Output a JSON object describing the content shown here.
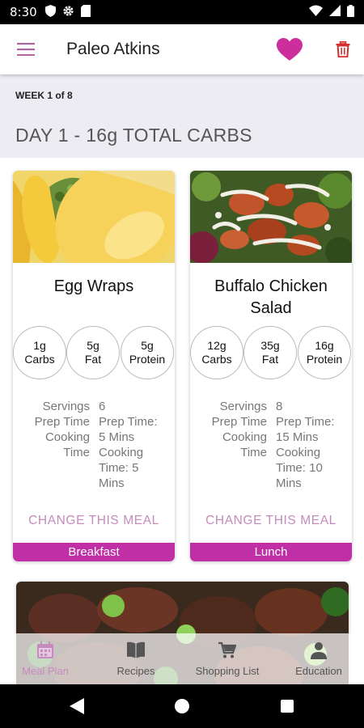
{
  "status_bar": {
    "time": "8:30"
  },
  "app_bar": {
    "title": "Paleo Atkins"
  },
  "week_label": "WEEK 1 of 8",
  "day_title": "DAY 1 - 16g TOTAL CARBS",
  "meals": [
    {
      "title": "Egg Wraps",
      "macros": [
        {
          "value": "1g",
          "label": "Carbs"
        },
        {
          "value": "5g",
          "label": "Fat"
        },
        {
          "value": "5g",
          "label": "Protein"
        }
      ],
      "detail_labels": [
        "Servings",
        "Prep Time",
        "Cooking",
        "Time"
      ],
      "detail_values": [
        "6",
        "Prep Time:",
        "5 Mins",
        "Cooking",
        "Time: 5",
        "Mins"
      ],
      "change_label": "CHANGE THIS MEAL",
      "meal_type": "Breakfast"
    },
    {
      "title": "Buffalo Chicken Salad",
      "macros": [
        {
          "value": "12g",
          "label": "Carbs"
        },
        {
          "value": "35g",
          "label": "Fat"
        },
        {
          "value": "16g",
          "label": "Protein"
        }
      ],
      "detail_labels": [
        "Servings",
        "Prep Time",
        "Cooking",
        "Time"
      ],
      "detail_values": [
        "8",
        "Prep Time:",
        "15 Mins",
        "Cooking",
        "Time: 10",
        "Mins"
      ],
      "change_label": "CHANGE THIS MEAL",
      "meal_type": "Lunch"
    }
  ],
  "bottom_nav": [
    {
      "label": "Meal Plan",
      "icon": "calendar-icon",
      "active": true
    },
    {
      "label": "Recipes",
      "icon": "book-icon",
      "active": false
    },
    {
      "label": "Shopping List",
      "icon": "cart-icon",
      "active": false
    },
    {
      "label": "Education",
      "icon": "person-icon",
      "active": false
    }
  ],
  "colors": {
    "accent": "#c02fa6",
    "accent_light": "#c58bbf",
    "heart": "#cc2f9b",
    "trash": "#d33030",
    "header_bg": "#ececf2"
  }
}
